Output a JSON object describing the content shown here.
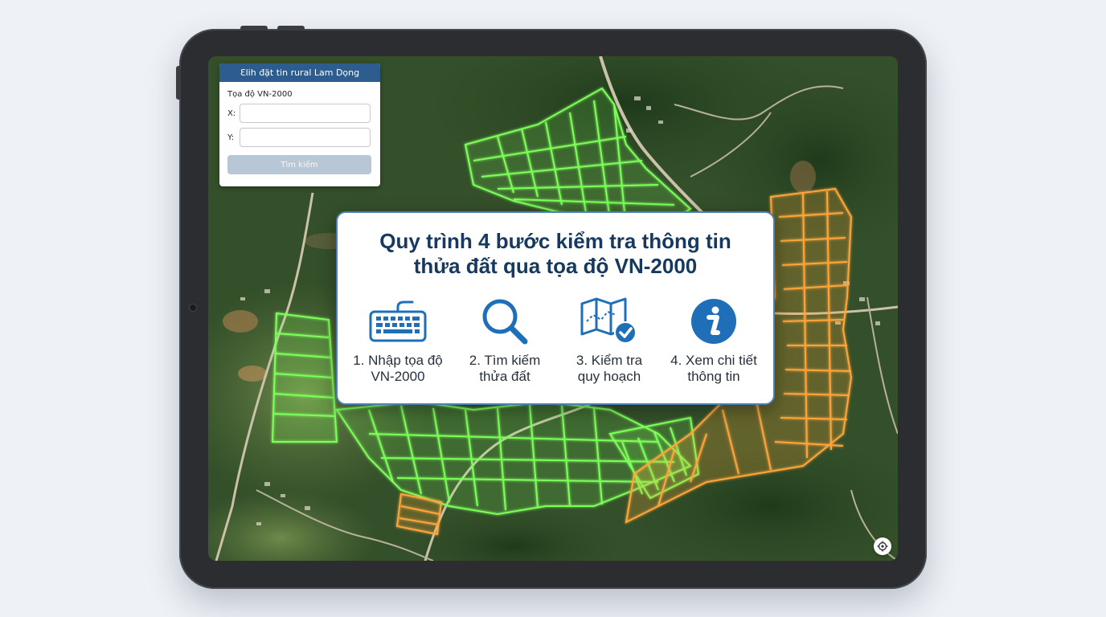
{
  "panel": {
    "title": "Ɛlih đặt tin rural Lam Dọng",
    "coord_label": "Tọa độ VN-2000",
    "x_label": "X:",
    "y_label": "Y:",
    "x_value": "",
    "y_value": "",
    "search_label": "Tìm kiếm"
  },
  "card": {
    "title_line1": "Quy trình 4 bước kiểm tra thông tin",
    "title_line2": "thửa đất qua tọa độ VN-2000",
    "steps": [
      {
        "icon": "keyboard-icon",
        "line1": "1. Nhập tọa độ",
        "line2": "VN-2000"
      },
      {
        "icon": "magnifier-icon",
        "line1": "2. Tìm kiếm",
        "line2": "thửa đất"
      },
      {
        "icon": "map-check-icon",
        "line1": "3. Kiểm tra",
        "line2": "quy hoạch"
      },
      {
        "icon": "info-icon",
        "line1": "4. Xem chi tiết",
        "line2": "thông tin"
      }
    ]
  },
  "map": {
    "locate_icon": "locate-icon",
    "parcel_colors": {
      "green": "#7dff5a",
      "orange": "#ffa53a"
    }
  },
  "colors": {
    "accent": "#2d5d8e",
    "title": "#17395e",
    "icon_blue": "#1f6fb8"
  }
}
